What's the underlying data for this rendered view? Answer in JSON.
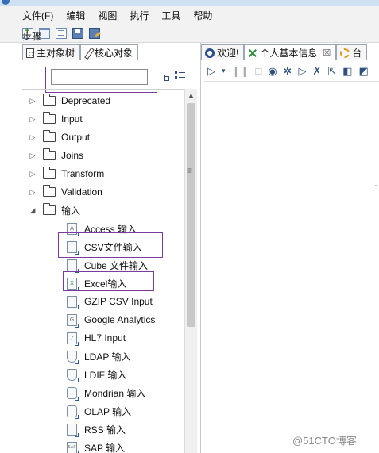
{
  "menubar": {
    "items": [
      "文件(F)",
      "编辑",
      "视图",
      "执行",
      "工具",
      "帮助"
    ]
  },
  "toolbar": {
    "icons": [
      "new-file-icon",
      "open-file-icon",
      "explore-repository-icon",
      "save-icon",
      "save-as-icon"
    ]
  },
  "left_panel": {
    "tabs": [
      {
        "label": "主对象树",
        "icon": "tree-icon",
        "active": false
      },
      {
        "label": "核心对象",
        "icon": "pencil-icon",
        "active": true
      }
    ],
    "step_label": "步骤",
    "search_value": "",
    "folders_collapsed": [
      "Deprecated",
      "Input",
      "Output",
      "Joins",
      "Transform",
      "Validation"
    ],
    "folder_expanded": "输入",
    "steps": [
      {
        "label": "Access 输入",
        "icon": "access-input-icon",
        "glyph": "A"
      },
      {
        "label": "CSV文件输入",
        "icon": "csv-file-input-icon",
        "glyph": ""
      },
      {
        "label": "Cube 文件输入",
        "icon": "cube-file-input-icon",
        "glyph": ""
      },
      {
        "label": "Excel输入",
        "icon": "excel-input-icon",
        "glyph": "X"
      },
      {
        "label": "GZIP CSV Input",
        "icon": "gzip-csv-input-icon",
        "glyph": ""
      },
      {
        "label": "Google Analytics",
        "icon": "google-analytics-icon",
        "glyph": "G"
      },
      {
        "label": "HL7 Input",
        "icon": "hl7-input-icon",
        "glyph": "7"
      },
      {
        "label": "LDAP 输入",
        "icon": "ldap-input-icon",
        "glyph": ""
      },
      {
        "label": "LDIF 输入",
        "icon": "ldif-input-icon",
        "glyph": ""
      },
      {
        "label": "Mondrian 输入",
        "icon": "mondrian-input-icon",
        "glyph": ""
      },
      {
        "label": "OLAP 输入",
        "icon": "olap-input-icon",
        "glyph": ""
      },
      {
        "label": "RSS 输入",
        "icon": "rss-input-icon",
        "glyph": ""
      },
      {
        "label": "SAP 输入",
        "icon": "sap-input-icon",
        "glyph": "SAP"
      }
    ]
  },
  "right_panel": {
    "tabs": [
      {
        "label": "欢迎!",
        "icon": "welcome-icon",
        "active": false
      },
      {
        "label": "个人基本信息",
        "icon": "transformation-icon",
        "active": true,
        "closable": true
      },
      {
        "label": "台",
        "icon": "job-icon",
        "active": false
      }
    ],
    "toolbar_icons": [
      "run-icon",
      "run-dropdown-icon",
      "pause-icon",
      "stop-icon",
      "preview-icon",
      "debug-icon",
      "replay-icon",
      "verify-icon",
      "analyze-icon",
      "sql-icon",
      "explore-db-icon"
    ]
  },
  "watermark": "@51CTO博客"
}
